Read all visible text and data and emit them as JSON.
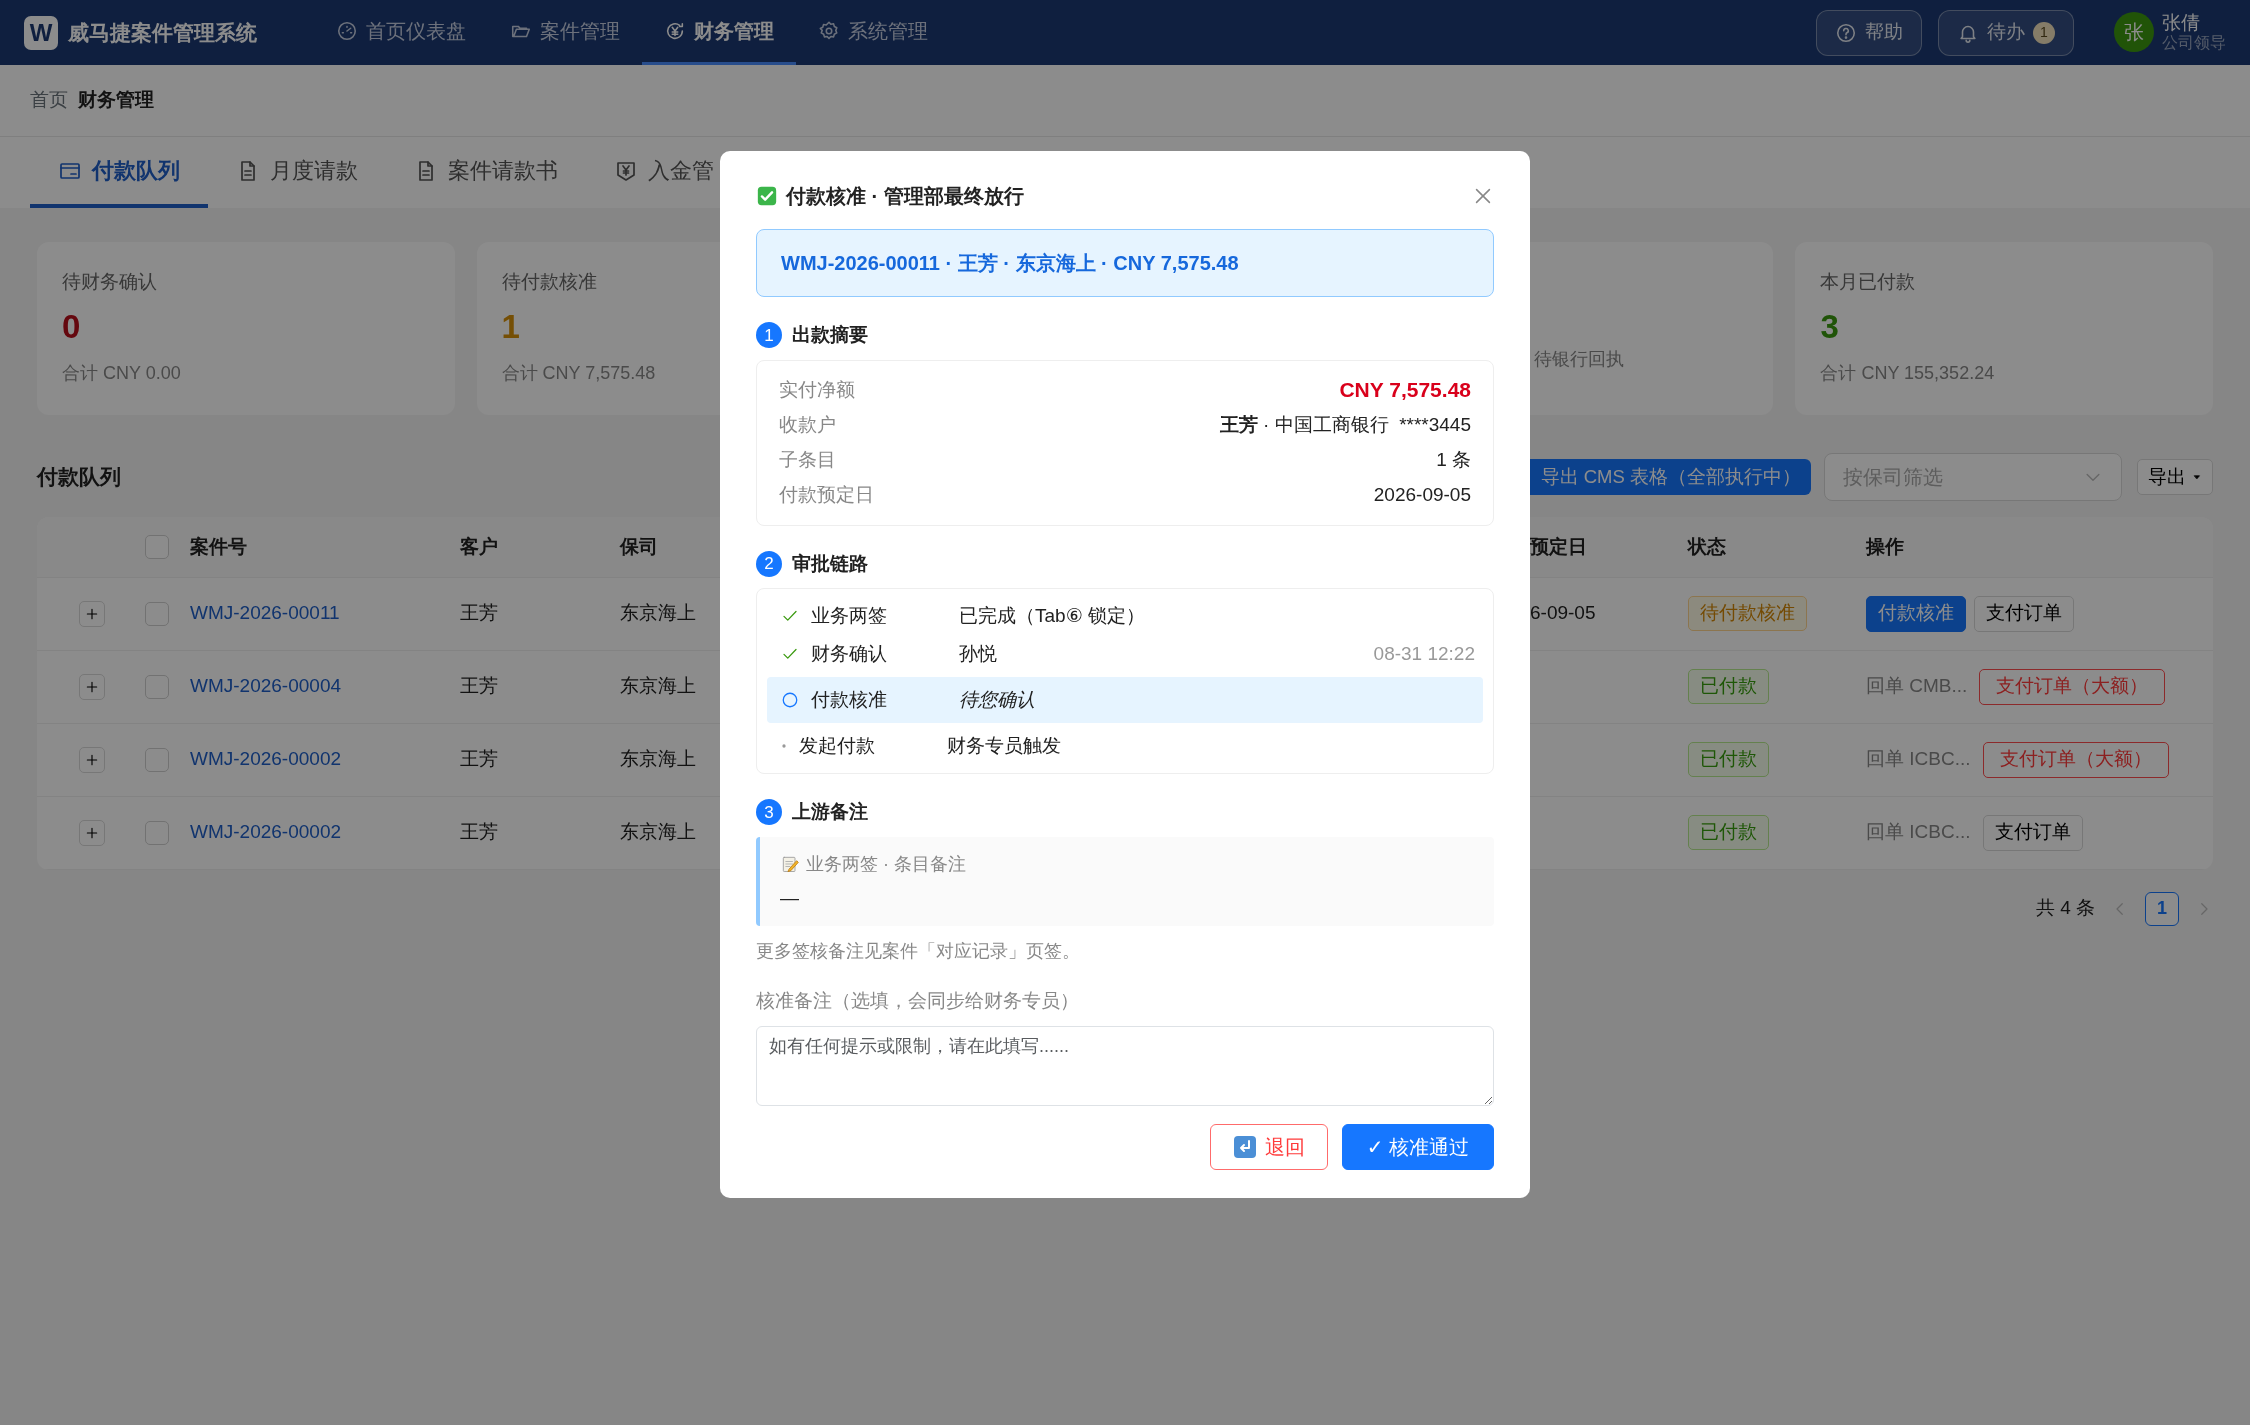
{
  "navbar": {
    "logo_letter": "W",
    "title": "威马捷案件管理系统",
    "items": [
      {
        "label": "首页仪表盘",
        "selected": false
      },
      {
        "label": "案件管理",
        "selected": false
      },
      {
        "label": "财务管理",
        "selected": true
      },
      {
        "label": "系统管理",
        "selected": false
      }
    ],
    "help_label": "帮助",
    "todo_label": "待办",
    "todo_count": "1",
    "user": {
      "avatar": "张",
      "name": "张倩",
      "role": "公司领导"
    }
  },
  "breadcrumb": [
    {
      "label": "首页",
      "current": false
    },
    {
      "label": "财务管理",
      "current": true
    }
  ],
  "tabs": [
    {
      "label": "付款队列",
      "selected": true
    },
    {
      "label": "月度请款",
      "selected": false
    },
    {
      "label": "案件请款书",
      "selected": false
    },
    {
      "label": "入金管",
      "selected": false
    }
  ],
  "stats": [
    {
      "kind": "alert",
      "title": "待财务确认",
      "value": "0",
      "sub": "合计 CNY 0.00"
    },
    {
      "kind": "pending",
      "title": "待付款核准",
      "value": "1",
      "sub": "合计 CNY 7,575.48"
    },
    {
      "kind": "partial",
      "sub": "待银行回执"
    },
    {
      "kind": "done",
      "title": "本月已付款",
      "value": "3",
      "sub": "合计 CNY 155,352.24"
    }
  ],
  "queue": {
    "title": "付款队列",
    "export_cms_label": "导出 CMS 表格（全部执行中）",
    "filter_placeholder": "按保司筛选",
    "export_label": "导出",
    "table": {
      "all_checked": false,
      "columns": [
        "案件号",
        "客户",
        "保司",
        "预定日",
        "状态",
        "操作"
      ],
      "rows": [
        {
          "expanded": false,
          "checked": false,
          "case_no": "WMJ-2026-00011",
          "client": "王芳",
          "insurer": "东京海上",
          "due": "6-09-05",
          "status": {
            "label": "待付款核准",
            "kind": "pending"
          },
          "actions": [
            {
              "label": "付款核准",
              "kind": "primary"
            },
            {
              "label": "支付订单",
              "kind": "plain"
            }
          ]
        },
        {
          "expanded": false,
          "checked": false,
          "case_no": "WMJ-2026-00004",
          "client": "王芳",
          "insurer": "东京海上",
          "status": {
            "label": "已付款",
            "kind": "paid"
          },
          "receipt": "回单 CMB...",
          "actions": [
            {
              "label": "支付订单（大额）",
              "kind": "danger"
            }
          ]
        },
        {
          "expanded": false,
          "checked": false,
          "case_no": "WMJ-2026-00002",
          "client": "王芳",
          "insurer": "东京海上",
          "status": {
            "label": "已付款",
            "kind": "paid"
          },
          "receipt": "回单 ICBC...",
          "actions": [
            {
              "label": "支付订单（大额）",
              "kind": "danger"
            }
          ]
        },
        {
          "expanded": false,
          "checked": false,
          "case_no": "WMJ-2026-00002",
          "client": "王芳",
          "insurer": "东京海上",
          "status": {
            "label": "已付款",
            "kind": "paid"
          },
          "receipt": "回单 ICBC...",
          "actions": [
            {
              "label": "支付订单",
              "kind": "plain"
            }
          ]
        }
      ]
    },
    "pagination": {
      "total": "共 4 条",
      "pages": [
        {
          "label": "1",
          "selected": true
        }
      ]
    }
  },
  "modal": {
    "title": "付款核准 · 管理部最终放行",
    "banner": "WMJ-2026-00011 · 王芳 · 东京海上 · CNY 7,575.48",
    "summary": {
      "number": "1",
      "title": "出款摘要",
      "rows": [
        {
          "kind": "amount",
          "label": "实付净额",
          "value": "CNY 7,575.48"
        },
        {
          "kind": "payee",
          "label": "收款户",
          "name": "王芳",
          "value": "· 中国工商银行  ****3445"
        },
        {
          "kind": "text",
          "label": "子条目",
          "value": "1 条"
        },
        {
          "kind": "text",
          "label": "付款预定日",
          "value": "2026-09-05"
        }
      ]
    },
    "approval": {
      "number": "2",
      "title": "审批链路",
      "steps": [
        {
          "kind": "done",
          "label": "业务两签",
          "detail": "已完成（Tab⑥ 锁定）"
        },
        {
          "kind": "done",
          "label": "财务确认",
          "detail": "孙悦",
          "time": "08-31 12:22"
        },
        {
          "kind": "current",
          "label": "付款核准",
          "detail": "待您确认"
        },
        {
          "kind": "pending",
          "label": "发起付款",
          "detail": "财务专员触发"
        }
      ]
    },
    "notes": {
      "number": "3",
      "title": "上游备注",
      "items": [
        {
          "title": "业务两签 · 条目备注",
          "body": "—"
        }
      ],
      "hint": "更多签核备注见案件「对应记录」页签。"
    },
    "remark": {
      "label": "核准备注（选填，会同步给财务专员）",
      "placeholder": "如有任何提示或限制，请在此填写......"
    },
    "buttons": [
      {
        "label": "退回",
        "kind": "danger"
      },
      {
        "label": "✓ 核准通过",
        "kind": "primary"
      }
    ]
  }
}
